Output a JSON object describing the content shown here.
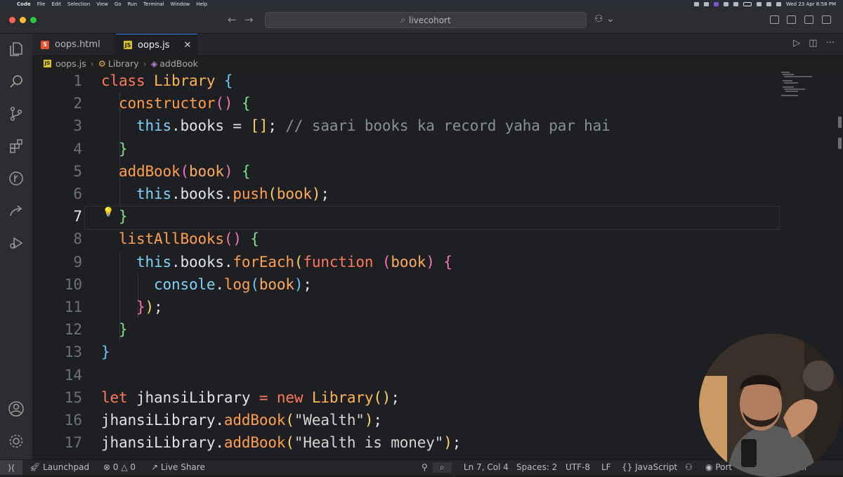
{
  "menubar": {
    "app": "Code",
    "items": [
      "File",
      "Edit",
      "Selection",
      "View",
      "Go",
      "Run",
      "Terminal",
      "Window",
      "Help"
    ],
    "clock": "Wed 23 Apr  8:58 PM"
  },
  "titlebar": {
    "search_text": "livecohort"
  },
  "tabs": [
    {
      "label": "oops.html",
      "icon": "html5-icon",
      "active": false
    },
    {
      "label": "oops.js",
      "icon": "js-icon",
      "active": true
    }
  ],
  "breadcrumb": {
    "file": "oops.js",
    "class": "Library",
    "method": "addBook"
  },
  "editor": {
    "active_line": 7,
    "line_numbers": [
      "1",
      "2",
      "3",
      "4",
      "5",
      "6",
      "7",
      "8",
      "9",
      "10",
      "11",
      "12",
      "13",
      "14",
      "15",
      "16",
      "17"
    ],
    "lines": [
      [
        [
          "kw",
          "class "
        ],
        [
          "cls",
          "Library"
        ],
        [
          "pr",
          " "
        ],
        [
          "brace-b",
          "{"
        ]
      ],
      [
        [
          "pr",
          "  "
        ],
        [
          "fn",
          "constructor"
        ],
        [
          "brace-p",
          "()"
        ],
        [
          "pr",
          " "
        ],
        [
          "brace-g",
          "{"
        ]
      ],
      [
        [
          "pr",
          "    "
        ],
        [
          "th",
          "this"
        ],
        [
          "pr",
          ".books = "
        ],
        [
          "brace-y",
          "[]"
        ],
        [
          "pr",
          "; "
        ],
        [
          "cm",
          "// saari books ka record yaha par hai"
        ]
      ],
      [
        [
          "pr",
          "  "
        ],
        [
          "brace-g",
          "}"
        ]
      ],
      [
        [
          "pr",
          "  "
        ],
        [
          "fn",
          "addBook"
        ],
        [
          "brace-p",
          "("
        ],
        [
          "pa",
          "book"
        ],
        [
          "brace-p",
          ")"
        ],
        [
          "pr",
          " "
        ],
        [
          "brace-g",
          "{"
        ]
      ],
      [
        [
          "pr",
          "    "
        ],
        [
          "th",
          "this"
        ],
        [
          "pr",
          ".books."
        ],
        [
          "fn",
          "push"
        ],
        [
          "brace-y",
          "("
        ],
        [
          "pa",
          "book"
        ],
        [
          "brace-y",
          ")"
        ],
        [
          "pr",
          ";"
        ]
      ],
      [
        [
          "pr",
          "  "
        ],
        [
          "brace-g",
          "}"
        ]
      ],
      [
        [
          "pr",
          "  "
        ],
        [
          "fn",
          "listAllBooks"
        ],
        [
          "brace-p",
          "()"
        ],
        [
          "pr",
          " "
        ],
        [
          "brace-g",
          "{"
        ]
      ],
      [
        [
          "pr",
          "    "
        ],
        [
          "th",
          "this"
        ],
        [
          "pr",
          ".books."
        ],
        [
          "fn",
          "forEach"
        ],
        [
          "brace-y",
          "("
        ],
        [
          "kw",
          "function"
        ],
        [
          "pr",
          " "
        ],
        [
          "brace-p",
          "("
        ],
        [
          "pa",
          "book"
        ],
        [
          "brace-p",
          ")"
        ],
        [
          "pr",
          " "
        ],
        [
          "brace-p",
          "{"
        ]
      ],
      [
        [
          "pr",
          "      "
        ],
        [
          "th",
          "console"
        ],
        [
          "pr",
          "."
        ],
        [
          "fn",
          "log"
        ],
        [
          "brace-b",
          "("
        ],
        [
          "pa",
          "book"
        ],
        [
          "brace-b",
          ")"
        ],
        [
          "pr",
          ";"
        ]
      ],
      [
        [
          "pr",
          "    "
        ],
        [
          "brace-p",
          "}"
        ],
        [
          "brace-y",
          ")"
        ],
        [
          "pr",
          ";"
        ]
      ],
      [
        [
          "pr",
          "  "
        ],
        [
          "brace-g",
          "}"
        ]
      ],
      [
        [
          "brace-b",
          "}"
        ]
      ],
      [],
      [
        [
          "kw",
          "let "
        ],
        [
          "pr",
          "jhansiLibrary "
        ],
        [
          "kw",
          "= new "
        ],
        [
          "cls",
          "Library"
        ],
        [
          "brace-y",
          "()"
        ],
        [
          "pr",
          ";"
        ]
      ],
      [
        [
          "pr",
          "jhansiLibrary."
        ],
        [
          "fn",
          "addBook"
        ],
        [
          "brace-y",
          "("
        ],
        [
          "str",
          "\"Wealth\""
        ],
        [
          "brace-y",
          ")"
        ],
        [
          "pr",
          ";"
        ]
      ],
      [
        [
          "pr",
          "jhansiLibrary."
        ],
        [
          "fn",
          "addBook"
        ],
        [
          "brace-y",
          "("
        ],
        [
          "str",
          "\"Health is money\""
        ],
        [
          "brace-y",
          ")"
        ],
        [
          "pr",
          ";"
        ]
      ]
    ]
  },
  "statusbar": {
    "launchpad": "Launchpad",
    "errors": "0",
    "warnings": "0",
    "liveshare": "Live Share",
    "position": "Ln 7, Col 4",
    "spaces": "Spaces: 2",
    "encoding": "UTF-8",
    "eol": "LF",
    "language": "JavaScript",
    "ports": "Port",
    "formatter": "tter"
  },
  "colors": {
    "keyword": "#ff7a59",
    "class": "#ffb454",
    "function": "#ff9e4d",
    "this": "#7fd3f7",
    "comment": "#8a8f98"
  }
}
